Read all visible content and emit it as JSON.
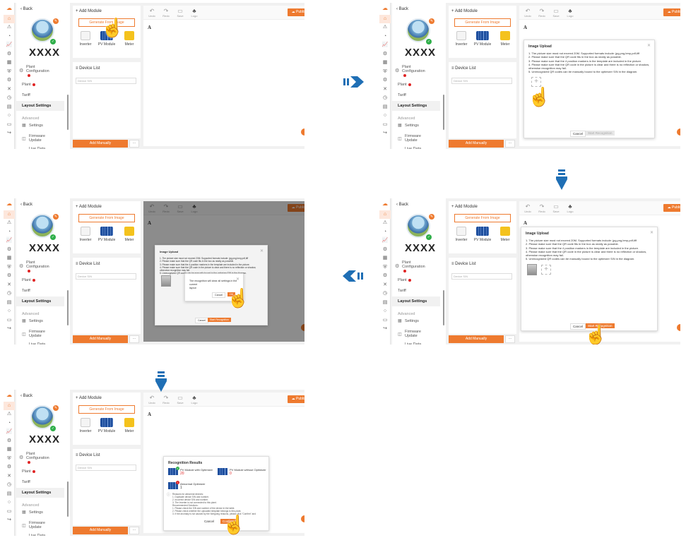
{
  "app": {
    "back_label": "Back",
    "site_name": "XXXX",
    "sidebar": {
      "plant_configuration": "Plant\nConfiguration",
      "plant": "Plant",
      "tariff": "Tariff",
      "layout_settings": "Layout Settings",
      "advanced": "Advanced",
      "settings": "Settings",
      "firmware_update": "Firmware\nUpdate",
      "live_data": "Live Data"
    },
    "add_module": {
      "title": "+ Add Module",
      "generate_button": "Generate From Image",
      "devices": [
        "Inverter",
        "PV Module",
        "Meter"
      ]
    },
    "device_list": {
      "title": "Device List",
      "search_placeholder": "Device S/N"
    },
    "add_manually": "Add Manually",
    "more": "···",
    "toolbar": {
      "undo": "Undo",
      "redo": "Redo",
      "save": "Save",
      "logo": "Logo",
      "publish": "Publish"
    },
    "canvas_marker": "A"
  },
  "upload_dialog": {
    "title": "Image Upload",
    "lines": [
      "1. The picture size must not exceed 20M. Supported formats include: jpg,png,bmp,pdf,tiff",
      "2. Please make sure that the QR code fits in the box as neatly as possible.",
      "3. Please make sure that the 4 position markers in the template are included in the picture.",
      "4. Please make sure that the QR code in the picture is clear and there is no reflection or shadow,",
      "otherwise recognition may fail.",
      "5. Unrecognized QR codes can be manually bound to the optimizer S/N in the diagram."
    ],
    "cancel": "Cancel",
    "start": "Start Recognition"
  },
  "confirm_dialog": {
    "text": "The recognition will clear all settings in the current\nlayout",
    "cancel": "Cancel",
    "ok": "OK"
  },
  "results_dialog": {
    "title": "Recognition Results",
    "with_opt_label": "PV Module with Optimizer",
    "with_opt_count": "20",
    "without_opt_label": "PV Module without Optimizer",
    "without_opt_count": "0",
    "abnormal_label": "Abnormal Optimizer",
    "abnormal_count": "1",
    "notes": [
      "Reasons for abnormal devices:",
      "1. Duplicate device S/N and number.",
      "2. Incorrect device S/N and number.",
      "3. The inverter is not connected to this plant.",
      "Recommended Solutions:",
      "1. Please check the S/N and number of the device in the table.",
      "2. Please check whether the uploaded template belongs to this plant.",
      "3. If the anomaly is not caused by the foregoing reasons, please click \"Confirm\" and"
    ],
    "cancel": "Cancel",
    "confirm": "Confirm"
  }
}
